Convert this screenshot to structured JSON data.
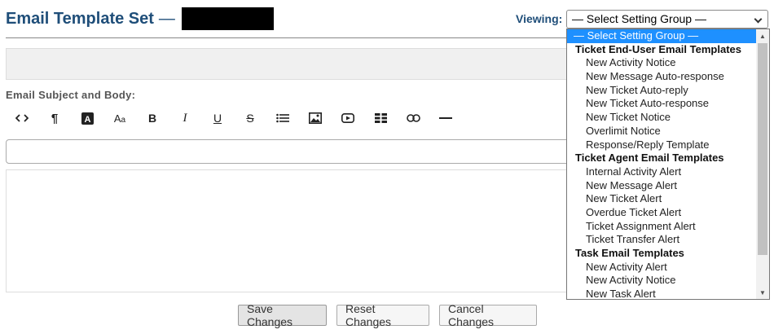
{
  "header": {
    "title": "Email Template Set",
    "dash": "—"
  },
  "viewing": {
    "label": "Viewing:",
    "selected": "— Select Setting Group —"
  },
  "editor": {
    "subject_label": "Email Subject and Body:",
    "toolbar": [
      {
        "name": "code-view-icon",
        "glyph": "<>"
      },
      {
        "name": "paragraph-icon",
        "glyph": "¶"
      },
      {
        "name": "font-color-icon",
        "glyph": "A"
      },
      {
        "name": "font-size-icon",
        "glyph": "Aa"
      },
      {
        "name": "bold-icon",
        "glyph": "B"
      },
      {
        "name": "italic-icon",
        "glyph": "I"
      },
      {
        "name": "underline-icon",
        "glyph": "U"
      },
      {
        "name": "strikethrough-icon",
        "glyph": "S"
      },
      {
        "name": "unordered-list-icon",
        "glyph": "list"
      },
      {
        "name": "image-icon",
        "glyph": "image"
      },
      {
        "name": "video-icon",
        "glyph": "video"
      },
      {
        "name": "table-icon",
        "glyph": "table"
      },
      {
        "name": "link-icon",
        "glyph": "link"
      },
      {
        "name": "horizontal-rule-icon",
        "glyph": "—"
      }
    ]
  },
  "buttons": {
    "save": "Save Changes",
    "reset": "Reset Changes",
    "cancel": "Cancel Changes"
  },
  "dropdown": {
    "options": [
      {
        "label": "— Select Setting Group —",
        "type": "selected"
      },
      {
        "label": "Ticket End-User Email Templates",
        "type": "group"
      },
      {
        "label": "New Activity Notice",
        "type": "option"
      },
      {
        "label": "New Message Auto-response",
        "type": "option"
      },
      {
        "label": "New Ticket Auto-reply",
        "type": "option"
      },
      {
        "label": "New Ticket Auto-response",
        "type": "option"
      },
      {
        "label": "New Ticket Notice",
        "type": "option"
      },
      {
        "label": "Overlimit Notice",
        "type": "option"
      },
      {
        "label": "Response/Reply Template",
        "type": "option"
      },
      {
        "label": "Ticket Agent Email Templates",
        "type": "group"
      },
      {
        "label": "Internal Activity Alert",
        "type": "option"
      },
      {
        "label": "New Message Alert",
        "type": "option"
      },
      {
        "label": "New Ticket Alert",
        "type": "option"
      },
      {
        "label": "Overdue Ticket Alert",
        "type": "option"
      },
      {
        "label": "Ticket Assignment Alert",
        "type": "option"
      },
      {
        "label": "Ticket Transfer Alert",
        "type": "option"
      },
      {
        "label": "Task Email Templates",
        "type": "group"
      },
      {
        "label": "New Activity Alert",
        "type": "option"
      },
      {
        "label": "New Activity Notice",
        "type": "option"
      },
      {
        "label": "New Task Alert",
        "type": "option"
      }
    ]
  },
  "colors": {
    "title": "#1f4e79",
    "selected_option_bg": "#1e90ff"
  }
}
